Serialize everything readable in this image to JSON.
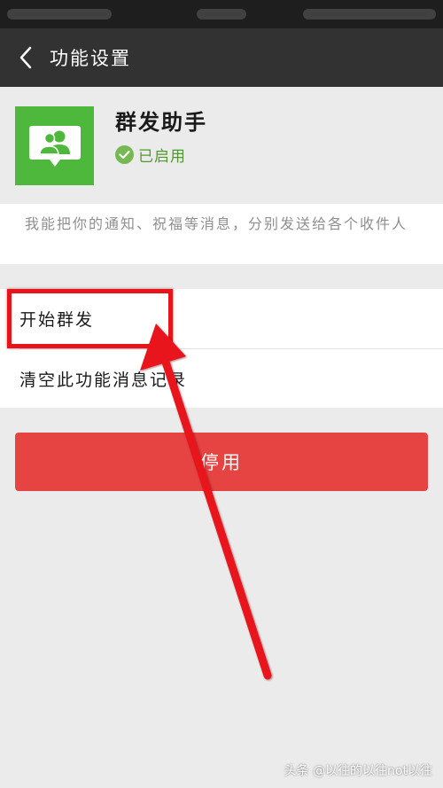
{
  "nav": {
    "title": "功能设置"
  },
  "app": {
    "name": "群发助手",
    "status": "已启用",
    "description": "我能把你的通知、祝福等消息，分别发送给各个收件人"
  },
  "menu": {
    "items": [
      {
        "label": "开始群发"
      },
      {
        "label": "清空此功能消息记录"
      }
    ]
  },
  "actions": {
    "disable_label": "停用"
  },
  "watermark": "头条 @以往的以往not以往",
  "colors": {
    "nav_bg": "#323232",
    "app_icon_bg": "#4eb83c",
    "status_green": "#4e9a2c",
    "danger_button": "#e64343",
    "annotation_red": "#e8141b"
  },
  "icons": {
    "back": "chevron-left-icon",
    "app": "group-chat-icon",
    "status": "check-circle-icon"
  }
}
